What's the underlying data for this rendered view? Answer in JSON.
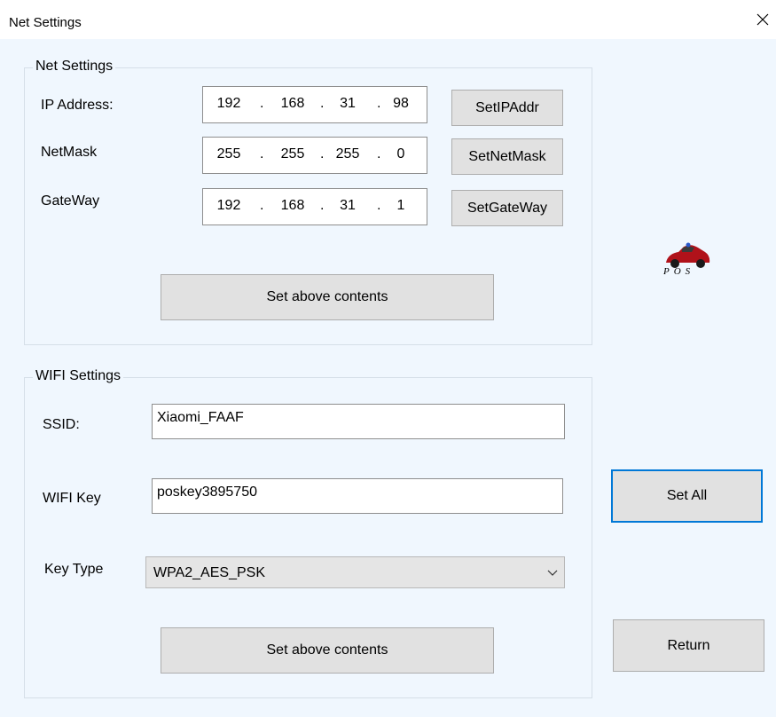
{
  "window": {
    "title": "Net Settings"
  },
  "net": {
    "legend": "Net Settings",
    "ip_label": "IP Address:",
    "ip": [
      "192",
      "168",
      "31",
      "98"
    ],
    "ip_button": "SetIPAddr",
    "mask_label": "NetMask",
    "mask": [
      "255",
      "255",
      "255",
      "0"
    ],
    "mask_button": "SetNetMask",
    "gw_label": "GateWay",
    "gw": [
      "192",
      "168",
      "31",
      "1"
    ],
    "gw_button": "SetGateWay",
    "dot": ".",
    "set_button": "Set above contents"
  },
  "logo": {
    "text": "POS",
    "icon": "red-car-logo-icon"
  },
  "wifi": {
    "legend": "WIFI Settings",
    "ssid_label": "SSID:",
    "ssid_value": "Xiaomi_FAAF",
    "key_label": "WIFI Key",
    "key_value": "poskey3895750",
    "type_label": "Key Type",
    "type_value": "WPA2_AES_PSK",
    "set_button": "Set above contents"
  },
  "actions": {
    "set_all": "Set All",
    "return": "Return"
  },
  "colors": {
    "background": "#f0f7fe",
    "focus_border": "#0078d7",
    "button": "#e1e1e1"
  }
}
